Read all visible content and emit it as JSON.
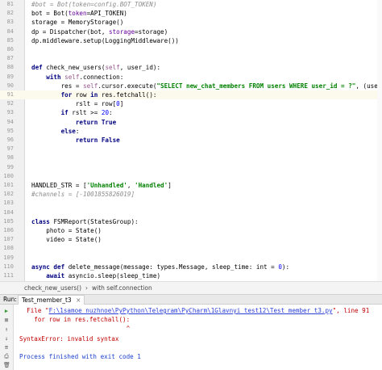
{
  "editor": {
    "lines": [
      {
        "n": "81",
        "active": false,
        "segs": [
          {
            "t": "#bot = Bot(token=config.BOT_TOKEN)",
            "c": "cmt"
          }
        ]
      },
      {
        "n": "82",
        "active": false,
        "segs": [
          {
            "t": "bot = Bot(",
            "c": ""
          },
          {
            "t": "token",
            "c": "kwarg"
          },
          {
            "t": "=API_TOKEN)",
            "c": ""
          }
        ]
      },
      {
        "n": "83",
        "active": false,
        "segs": [
          {
            "t": "storage = MemoryStorage()",
            "c": ""
          }
        ]
      },
      {
        "n": "84",
        "active": false,
        "segs": [
          {
            "t": "dp = Dispatcher(bot, ",
            "c": ""
          },
          {
            "t": "storage",
            "c": "kwarg"
          },
          {
            "t": "=storage)",
            "c": ""
          }
        ]
      },
      {
        "n": "85",
        "active": false,
        "segs": [
          {
            "t": "dp.middleware.setup(LoggingMiddleware())",
            "c": ""
          }
        ]
      },
      {
        "n": "86",
        "active": false,
        "segs": []
      },
      {
        "n": "87",
        "active": false,
        "segs": []
      },
      {
        "n": "88",
        "active": false,
        "segs": [
          {
            "t": "def ",
            "c": "kw"
          },
          {
            "t": "check_new_users(",
            "c": ""
          },
          {
            "t": "self",
            "c": "self"
          },
          {
            "t": ", user_id):",
            "c": ""
          }
        ]
      },
      {
        "n": "89",
        "active": false,
        "segs": [
          {
            "t": "    with ",
            "c": "kw"
          },
          {
            "t": "self",
            "c": "self"
          },
          {
            "t": ".connection:",
            "c": ""
          }
        ]
      },
      {
        "n": "90",
        "active": false,
        "segs": [
          {
            "t": "        res = ",
            "c": ""
          },
          {
            "t": "self",
            "c": "self"
          },
          {
            "t": ".cursor.execute(",
            "c": ""
          },
          {
            "t": "\"SELECT new_chat_members FROM users WHERE user_id = ?\"",
            "c": "str"
          },
          {
            "t": ", (user_id,)",
            "c": ""
          }
        ]
      },
      {
        "n": "91",
        "active": true,
        "segs": [
          {
            "t": "        for ",
            "c": "kw"
          },
          {
            "t": "row ",
            "c": ""
          },
          {
            "t": "in ",
            "c": "kw"
          },
          {
            "t": "res.fetchall():",
            "c": ""
          }
        ]
      },
      {
        "n": "92",
        "active": false,
        "segs": [
          {
            "t": "            rslt = row[",
            "c": ""
          },
          {
            "t": "0",
            "c": "num"
          },
          {
            "t": "]",
            "c": ""
          }
        ]
      },
      {
        "n": "93",
        "active": false,
        "segs": [
          {
            "t": "        if ",
            "c": "kw"
          },
          {
            "t": "rslt >= ",
            "c": ""
          },
          {
            "t": "20",
            "c": "num"
          },
          {
            "t": ":",
            "c": ""
          }
        ]
      },
      {
        "n": "94",
        "active": false,
        "segs": [
          {
            "t": "            return True",
            "c": "kw"
          }
        ]
      },
      {
        "n": "95",
        "active": false,
        "segs": [
          {
            "t": "        else",
            "c": "kw"
          },
          {
            "t": ":",
            "c": ""
          }
        ]
      },
      {
        "n": "96",
        "active": false,
        "segs": [
          {
            "t": "            return False",
            "c": "kw"
          }
        ]
      },
      {
        "n": "97",
        "active": false,
        "segs": []
      },
      {
        "n": "98",
        "active": false,
        "segs": []
      },
      {
        "n": "99",
        "active": false,
        "segs": []
      },
      {
        "n": "100",
        "active": false,
        "segs": []
      },
      {
        "n": "101",
        "active": false,
        "segs": [
          {
            "t": "HANDLED_STR = [",
            "c": ""
          },
          {
            "t": "'Unhandled'",
            "c": "str"
          },
          {
            "t": ", ",
            "c": ""
          },
          {
            "t": "'Handled'",
            "c": "str"
          },
          {
            "t": "]",
            "c": ""
          }
        ]
      },
      {
        "n": "102",
        "active": false,
        "segs": [
          {
            "t": "#channels = [-1001855826019]",
            "c": "cmt"
          }
        ]
      },
      {
        "n": "103",
        "active": false,
        "segs": []
      },
      {
        "n": "104",
        "active": false,
        "segs": []
      },
      {
        "n": "105",
        "active": false,
        "segs": [
          {
            "t": "class ",
            "c": "kw"
          },
          {
            "t": "FSMReport(StatesGroup):",
            "c": ""
          }
        ]
      },
      {
        "n": "106",
        "active": false,
        "segs": [
          {
            "t": "    photo = State()",
            "c": ""
          }
        ]
      },
      {
        "n": "107",
        "active": false,
        "segs": [
          {
            "t": "    video = State()",
            "c": ""
          }
        ]
      },
      {
        "n": "108",
        "active": false,
        "segs": []
      },
      {
        "n": "109",
        "active": false,
        "segs": []
      },
      {
        "n": "110",
        "active": false,
        "segs": [
          {
            "t": "async def ",
            "c": "kw"
          },
          {
            "t": "delete_message(message: types.Message, sleep_time: ",
            "c": ""
          },
          {
            "t": "int",
            "c": ""
          },
          {
            "t": " = ",
            "c": ""
          },
          {
            "t": "0",
            "c": "num"
          },
          {
            "t": "):",
            "c": ""
          }
        ]
      },
      {
        "n": "111",
        "active": false,
        "segs": [
          {
            "t": "    await ",
            "c": "kw"
          },
          {
            "t": "asyncio.sleep(sleep_time)",
            "c": ""
          }
        ]
      }
    ]
  },
  "breadcrumb": {
    "item1": "check_new_users()",
    "separator": "›",
    "item2": "with self.connection"
  },
  "run_panel": {
    "label": "Run:",
    "tab_label": "Test_member_t3",
    "tab_close": "×"
  },
  "console": {
    "file_prefix": "  File \"",
    "file_path": "F:\\1samoe_nuzhnoe\\PyPython\\Telegram\\PyCharm\\1Glavnyi_test12\\Test_member_t3.py",
    "file_suffix": "\", line 91",
    "code_line": "    for row in res.fetchall():",
    "caret_line": "                             ^",
    "error_line": "SyntaxError: invalid syntax",
    "exit_line": "Process finished with exit code 1"
  },
  "icons": [
    "run-icon",
    "stop-icon",
    "up-arrow-icon",
    "down-arrow-icon",
    "soft-wrap-icon",
    "print-icon",
    "trash-icon"
  ]
}
